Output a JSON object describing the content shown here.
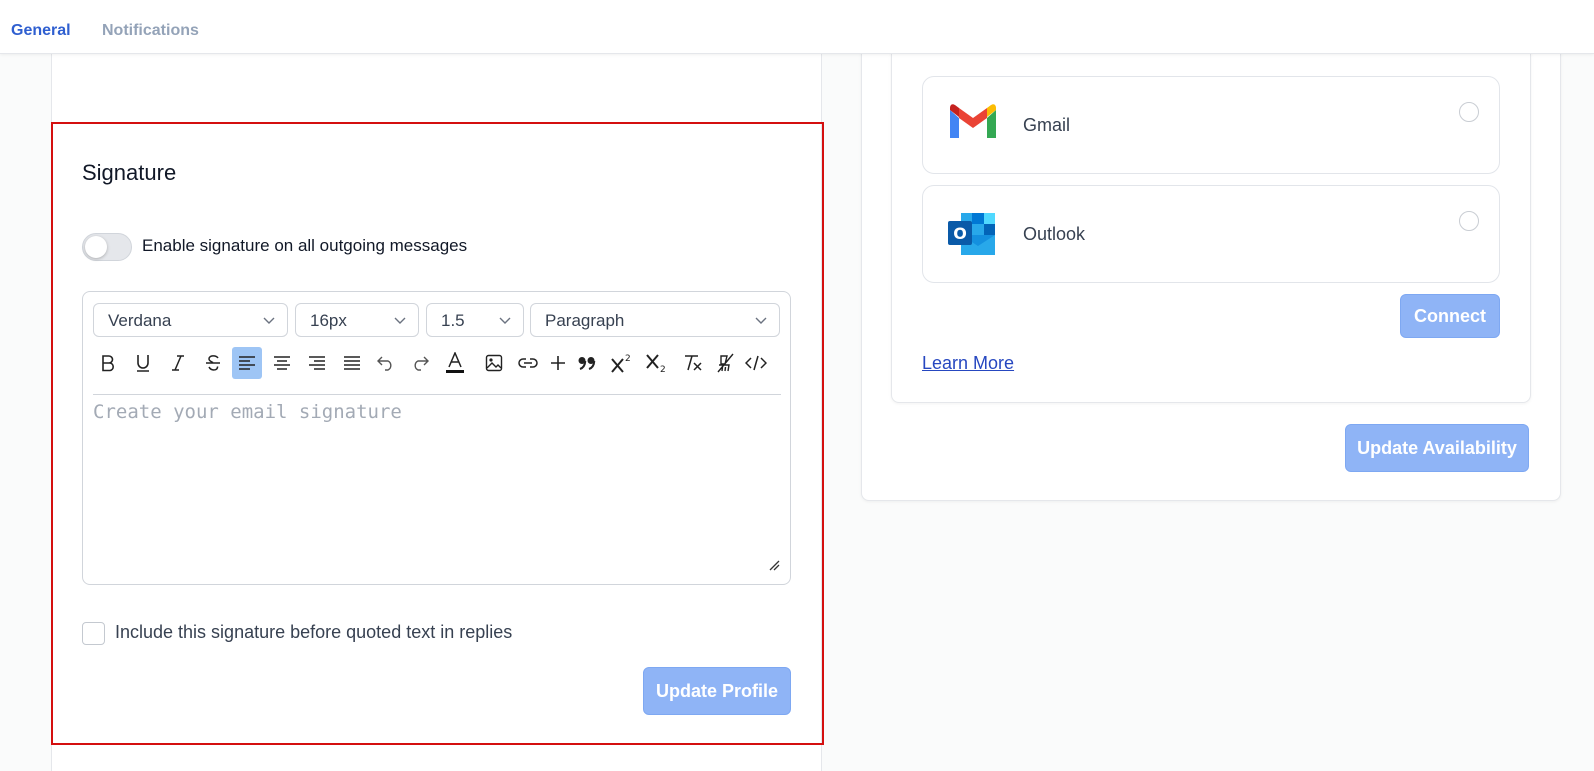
{
  "tabs": [
    {
      "label": "General",
      "active": true
    },
    {
      "label": "Notifications",
      "active": false
    }
  ],
  "signature": {
    "title": "Signature",
    "toggle_label": "Enable signature on all outgoing messages",
    "toggle_on": false,
    "editor": {
      "font_family": "Verdana",
      "font_size": "16px",
      "line_height": "1.5",
      "block_format": "Paragraph",
      "placeholder": "Create your email signature",
      "toolbar": [
        "bold-icon",
        "underline-icon",
        "italic-icon",
        "strikethrough-icon",
        "align-left-icon",
        "align-center-icon",
        "align-right-icon",
        "align-justify-icon",
        "undo-icon",
        "redo-icon",
        "text-color-icon",
        "image-icon",
        "link-icon",
        "plus-icon",
        "quote-icon",
        "superscript-icon",
        "subscript-icon",
        "clear-format-icon",
        "clear-style-icon",
        "code-icon"
      ],
      "active_tool": "align-left-icon"
    },
    "checkbox_label": "Include this signature before quoted text in replies",
    "checkbox_checked": false,
    "update_button": "Update Profile"
  },
  "email_providers": {
    "providers": [
      {
        "name": "Gmail",
        "icon": "gmail-logo",
        "selected": false
      },
      {
        "name": "Outlook",
        "icon": "outlook-logo",
        "selected": false
      }
    ],
    "connect_button": "Connect",
    "learn_more": "Learn More",
    "update_button": "Update Availability"
  },
  "colors": {
    "accent": "#2f5fd0",
    "button_disabled": "#8fb4f6",
    "highlight_border": "#d40f0f",
    "link": "#2647c0"
  }
}
